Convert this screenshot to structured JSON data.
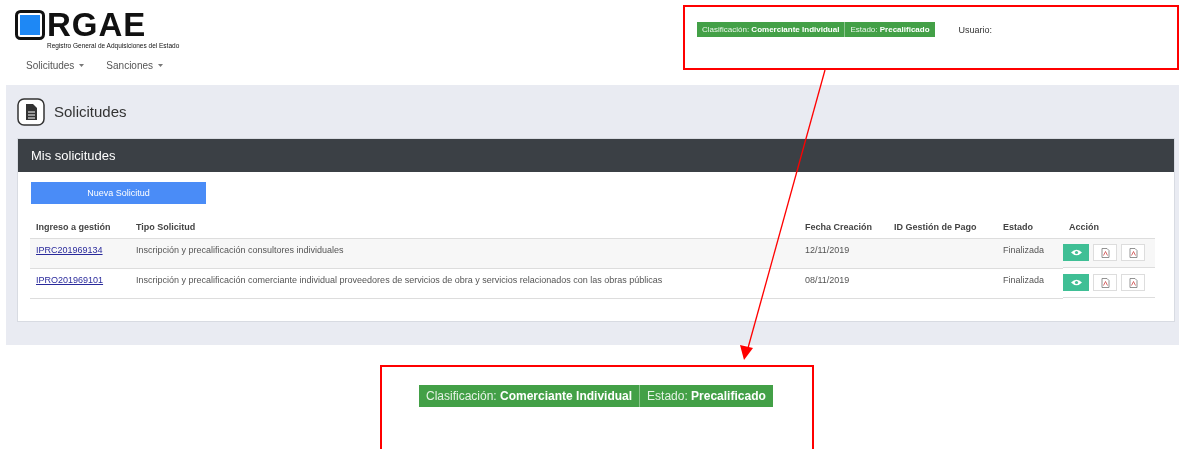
{
  "header": {
    "logo_text": "RGAE",
    "logo_subtitle": "Registro General de Adquisiciones del Estado",
    "nav": [
      {
        "label": "Solicitudes"
      },
      {
        "label": "Sanciones"
      }
    ],
    "status": {
      "classification": "Clasificación: **Comerciante Individual**",
      "state": "Estado: **Precalificado**",
      "user_label": "Usuario:"
    }
  },
  "page": {
    "title": "Solicitudes"
  },
  "card": {
    "title": "Mis solicitudes",
    "new_button": "Nueva Solicitud",
    "columns": [
      "Ingreso a gestión",
      "Tipo Solicitud",
      "Fecha Creación",
      "ID Gestión de Pago",
      "Estado",
      "Acción"
    ],
    "rows": [
      {
        "code": "IPRC201969134",
        "type": "Inscripción y precalificación consultores individuales",
        "date": "12/11/2019",
        "status": "Finalizada"
      },
      {
        "code": "IPRO201969101",
        "type": "Inscripción y precalificación comerciante individual proveedores de servicios de obra y servicios relacionados con las obras públicas",
        "date": "08/11/2019",
        "status": "Finalizada"
      }
    ]
  },
  "callout": {
    "classification": "Clasificación: **Comerciante Individual**",
    "state": "Estado: **Precalificado**"
  }
}
